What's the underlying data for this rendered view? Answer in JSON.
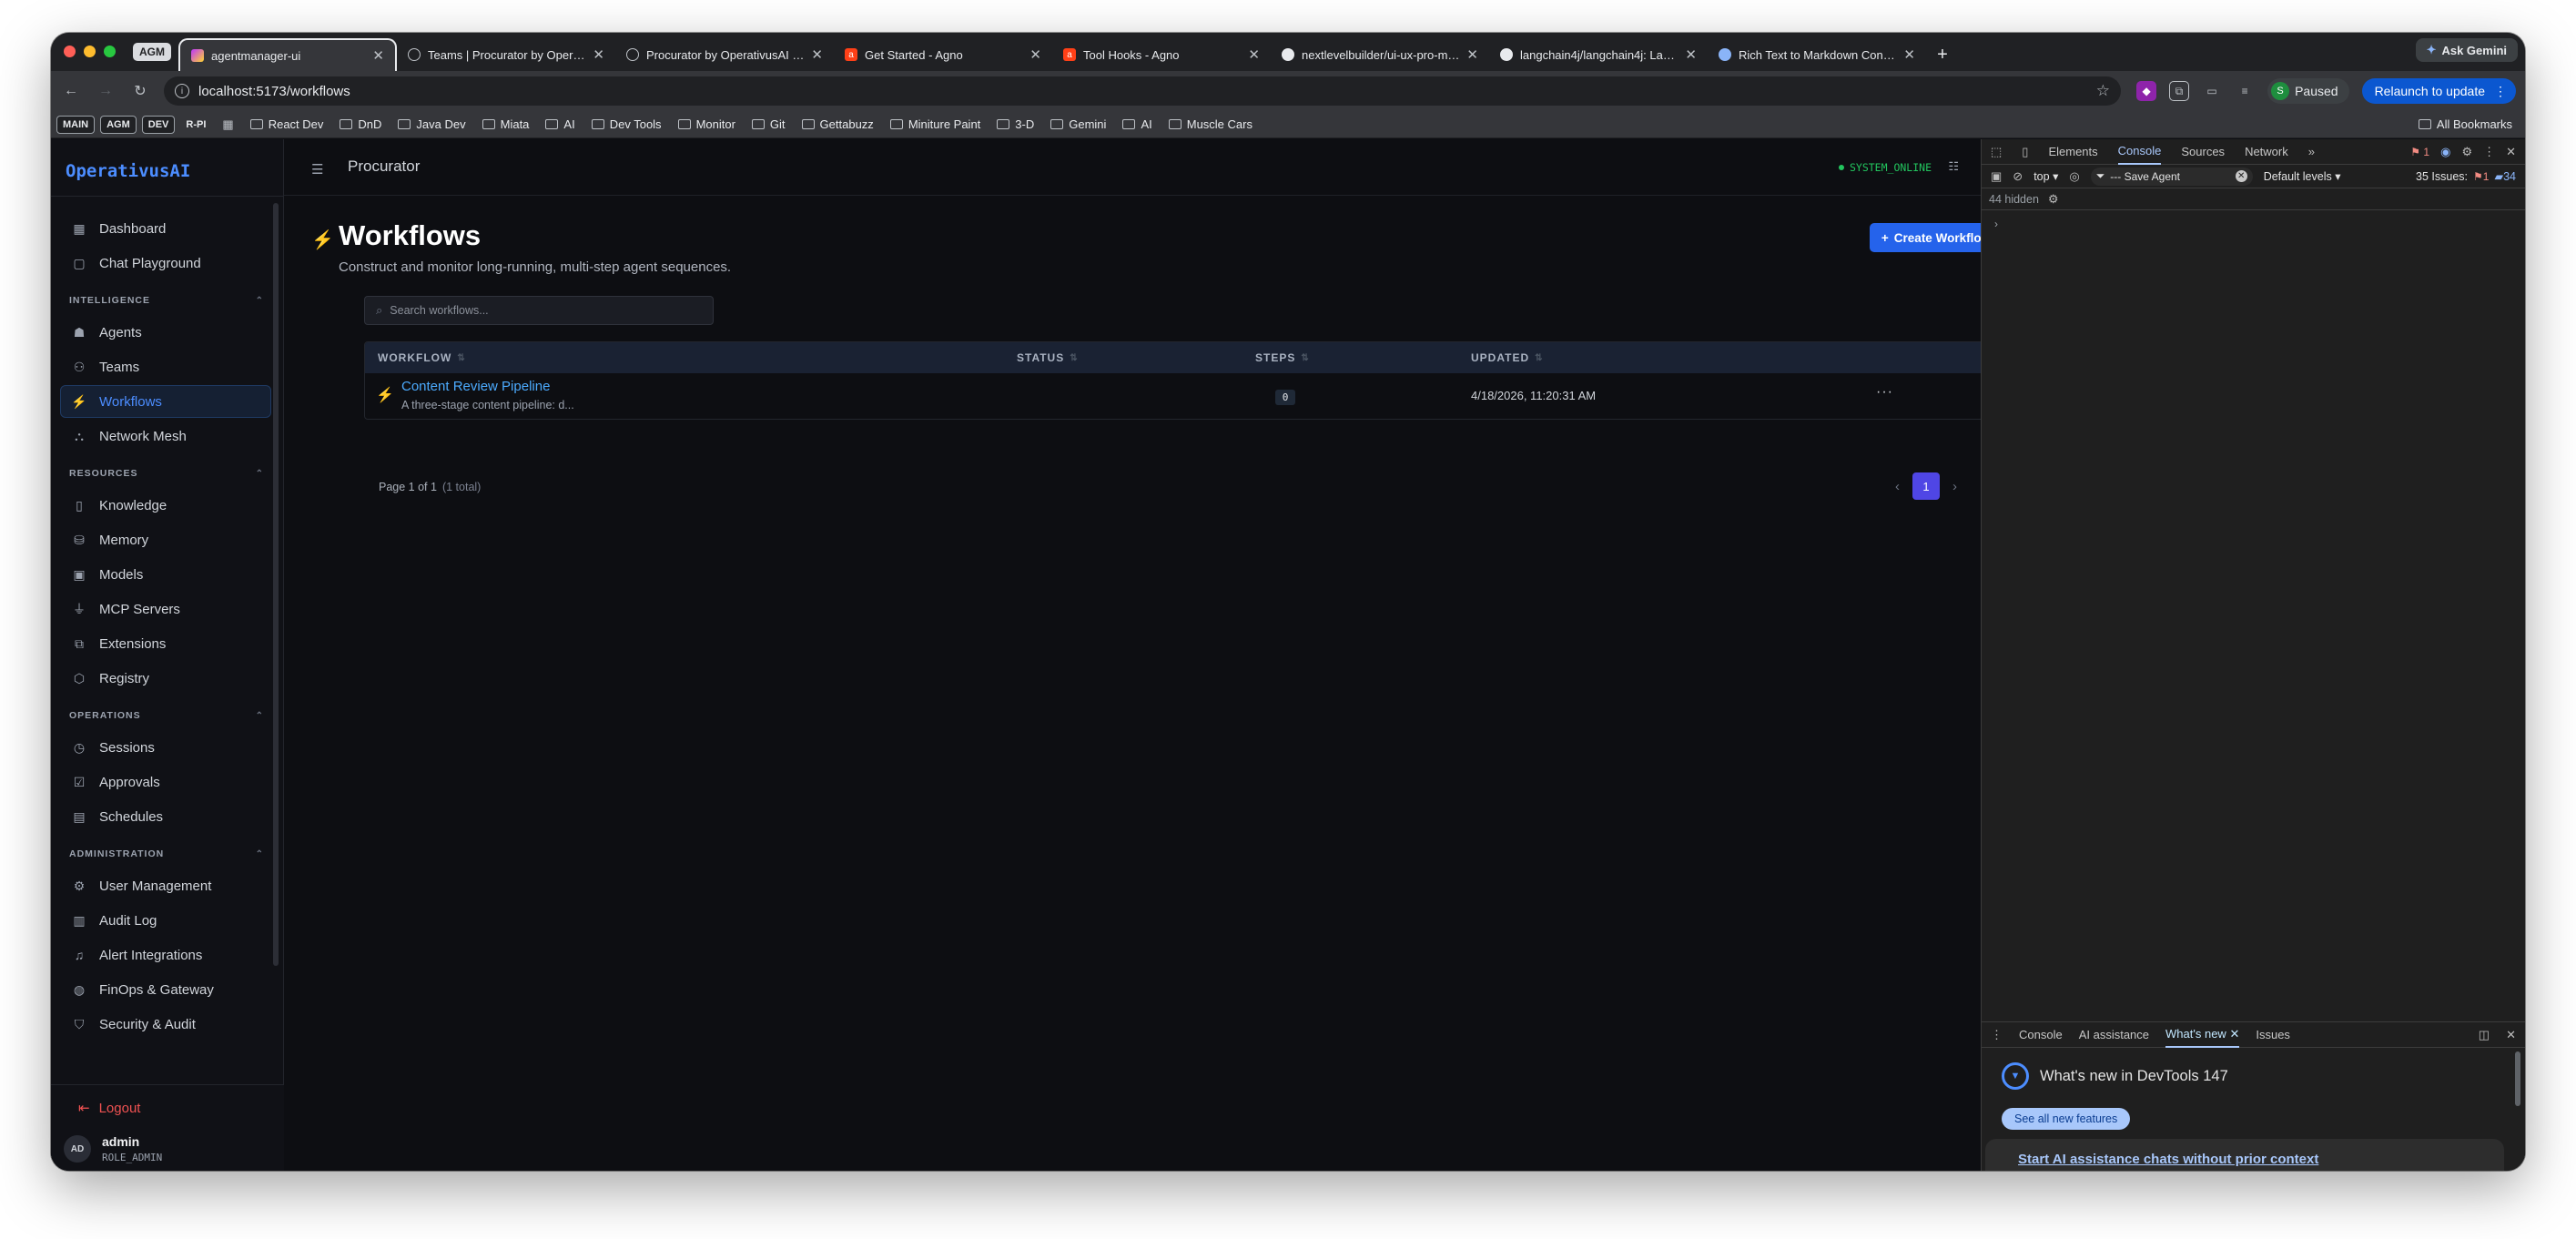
{
  "browser": {
    "tab_group_label": "AGM",
    "tabs": [
      {
        "title": "agentmanager-ui",
        "favicon": "vite-icon",
        "active": true
      },
      {
        "title": "Teams | Procurator by Operati…",
        "favicon": "globe-icon"
      },
      {
        "title": "Procurator by OperativusAI |…",
        "favicon": "globe-icon"
      },
      {
        "title": "Get Started - Agno",
        "favicon": "agno-icon"
      },
      {
        "title": "Tool Hooks - Agno",
        "favicon": "agno-icon"
      },
      {
        "title": "nextlevelbuilder/ui-ux-pro-m…",
        "favicon": "github-icon"
      },
      {
        "title": "langchain4j/langchain4j: Lang…",
        "favicon": "github-icon"
      },
      {
        "title": "Rich Text to Markdown Conve…",
        "favicon": "web-icon"
      }
    ],
    "ask_gemini": "Ask Gemini",
    "url": "localhost:5173/workflows",
    "profile_initial": "S",
    "profile_status": "Paused",
    "relaunch_label": "Relaunch to update",
    "bookmark_chips": [
      "MAIN",
      "AGM",
      "DEV",
      "R-PI"
    ],
    "bookmarks": [
      "React Dev",
      "DnD",
      "Java Dev",
      "Miata",
      "AI",
      "Dev Tools",
      "Monitor",
      "Git",
      "Gettabuzz",
      "Miniture Paint",
      "3-D",
      "Gemini",
      "AI",
      "Muscle Cars"
    ],
    "all_bookmarks": "All Bookmarks"
  },
  "sidebar": {
    "brand": "OperativusAI",
    "top_items": [
      {
        "label": "Dashboard",
        "icon": "dashboard-icon"
      },
      {
        "label": "Chat Playground",
        "icon": "chat-icon"
      }
    ],
    "sections": [
      {
        "title": "INTELLIGENCE",
        "items": [
          {
            "label": "Agents",
            "icon": "bot-icon"
          },
          {
            "label": "Teams",
            "icon": "users-icon"
          },
          {
            "label": "Workflows",
            "icon": "workflow-icon",
            "active": true
          },
          {
            "label": "Network Mesh",
            "icon": "network-icon"
          }
        ]
      },
      {
        "title": "RESOURCES",
        "items": [
          {
            "label": "Knowledge",
            "icon": "book-icon"
          },
          {
            "label": "Memory",
            "icon": "database-icon"
          },
          {
            "label": "Models",
            "icon": "cpu-icon"
          },
          {
            "label": "MCP Servers",
            "icon": "plug-icon"
          },
          {
            "label": "Extensions",
            "icon": "puzzle-icon"
          },
          {
            "label": "Registry",
            "icon": "package-icon"
          }
        ]
      },
      {
        "title": "OPERATIONS",
        "items": [
          {
            "label": "Sessions",
            "icon": "history-icon"
          },
          {
            "label": "Approvals",
            "icon": "check-square-icon"
          },
          {
            "label": "Schedules",
            "icon": "calendar-icon"
          }
        ]
      },
      {
        "title": "ADMINISTRATION",
        "items": [
          {
            "label": "User Management",
            "icon": "user-cog-icon"
          },
          {
            "label": "Audit Log",
            "icon": "clipboard-icon"
          },
          {
            "label": "Alert Integrations",
            "icon": "bell-icon"
          },
          {
            "label": "FinOps & Gateway",
            "icon": "globe-icon"
          },
          {
            "label": "Security & Audit",
            "icon": "shield-icon"
          }
        ]
      }
    ],
    "logout": "Logout",
    "user": {
      "initials": "AD",
      "name": "admin",
      "role": "ROLE_ADMIN"
    }
  },
  "topbar": {
    "breadcrumb": "Procurator",
    "status": "SYSTEM_ONLINE"
  },
  "page": {
    "title": "Workflows",
    "subtitle": "Construct and monitor long-running, multi-step agent sequences.",
    "create_button": "Create Workflow",
    "search_placeholder": "Search workflows...",
    "columns": [
      "WORKFLOW",
      "STATUS",
      "STEPS",
      "UPDATED"
    ],
    "rows": [
      {
        "name": "Content Review Pipeline",
        "description": "A three-stage content pipeline: d...",
        "status": "",
        "steps": "0",
        "updated": "4/18/2026, 11:20:31 AM"
      }
    ],
    "pager_text": "Page 1 of 1",
    "pager_total": "(1 total)",
    "current_page": "1"
  },
  "devtools": {
    "tabs": [
      "Elements",
      "Console",
      "Sources",
      "Network"
    ],
    "active_tab": "Console",
    "error_count": "1",
    "context": "top",
    "filter_value": "--- Save Agent",
    "levels": "Default levels",
    "issues_label": "35 Issues:",
    "issues_errors": "1",
    "issues_info": "34",
    "hidden": "44 hidden",
    "drawer_tabs": [
      "Console",
      "AI assistance",
      "What's new",
      "Issues"
    ],
    "drawer_active": "What's new",
    "whats_new_title": "What's new in DevTools 147",
    "see_all": "See all new features",
    "card_link": "Start AI assistance chats without prior context"
  },
  "colors": {
    "accent": "#2563eb",
    "brand": "#4c8dff",
    "online": "#22c55e",
    "page_active": "#4f46e5",
    "app_bg": "#0d0e12"
  }
}
